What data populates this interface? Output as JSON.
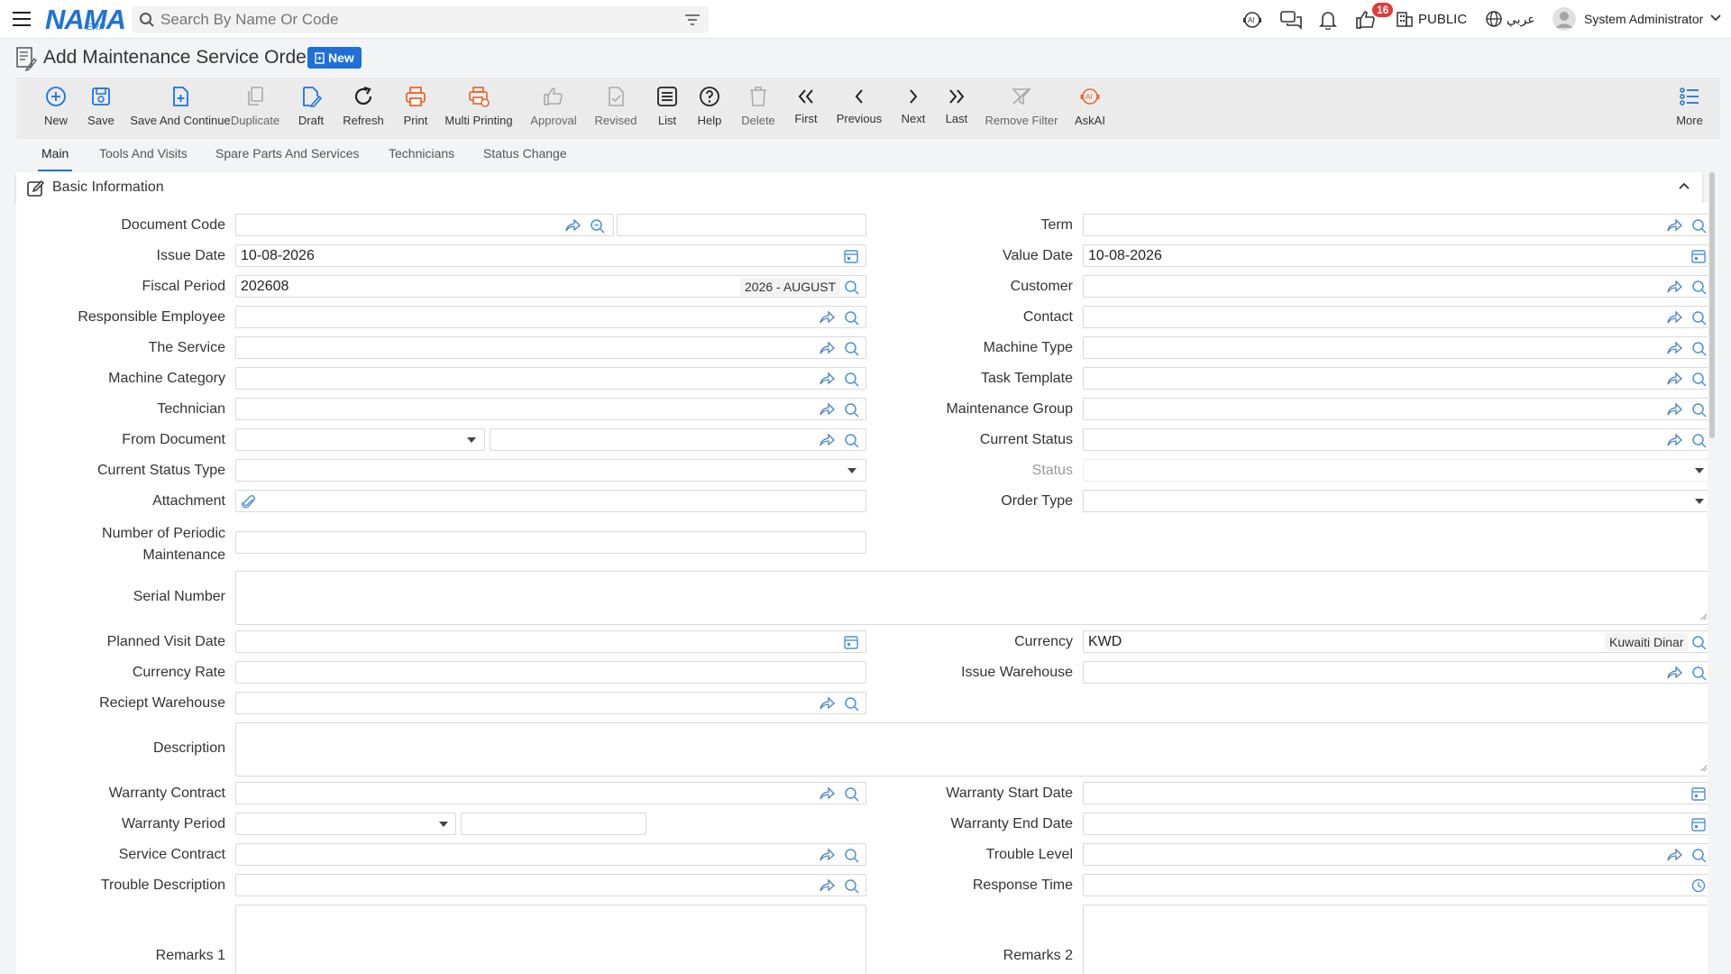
{
  "header": {
    "logo": "NAMA",
    "logo_sub": "ERP",
    "search_placeholder": "Search By Name Or Code",
    "notification_count": "16",
    "company": "PUBLIC",
    "language": "عربي",
    "user": "System Administrator"
  },
  "page": {
    "title": "Add Maintenance Service Order",
    "badge": "New"
  },
  "toolbar": {
    "new": "New",
    "save": "Save",
    "save_continue": "Save And Continue",
    "duplicate": "Duplicate",
    "draft": "Draft",
    "refresh": "Refresh",
    "print": "Print",
    "multi_printing": "Multi Printing",
    "approval": "Approval",
    "revised": "Revised",
    "list": "List",
    "help": "Help",
    "delete": "Delete",
    "first": "First",
    "previous": "Previous",
    "next": "Next",
    "last": "Last",
    "remove_filter": "Remove Filter",
    "askai": "AskAI",
    "more": "More"
  },
  "tabs": [
    "Main",
    "Tools And Visits",
    "Spare Parts And Services",
    "Technicians",
    "Status Change"
  ],
  "section": {
    "title": "Basic Information"
  },
  "form": {
    "document_code": {
      "label": "Document Code",
      "value": ""
    },
    "term": {
      "label": "Term",
      "value": ""
    },
    "issue_date": {
      "label": "Issue Date",
      "value": "10-08-2026"
    },
    "value_date": {
      "label": "Value Date",
      "value": "10-08-2026"
    },
    "fiscal_period": {
      "label": "Fiscal Period",
      "value": "202608",
      "tag": "2026 - AUGUST"
    },
    "customer": {
      "label": "Customer",
      "value": ""
    },
    "responsible_employee": {
      "label": "Responsible Employee",
      "value": ""
    },
    "contact": {
      "label": "Contact",
      "value": ""
    },
    "the_service": {
      "label": "The Service",
      "value": ""
    },
    "machine_type": {
      "label": "Machine Type",
      "value": ""
    },
    "machine_category": {
      "label": "Machine Category",
      "value": ""
    },
    "task_template": {
      "label": "Task Template",
      "value": ""
    },
    "technician": {
      "label": "Technician",
      "value": ""
    },
    "maintenance_group": {
      "label": "Maintenance Group",
      "value": ""
    },
    "from_document": {
      "label": "From Document",
      "value": ""
    },
    "current_status": {
      "label": "Current Status",
      "value": ""
    },
    "current_status_type": {
      "label": "Current Status Type",
      "value": ""
    },
    "status": {
      "label": "Status",
      "value": ""
    },
    "attachment": {
      "label": "Attachment",
      "value": ""
    },
    "order_type": {
      "label": "Order Type",
      "value": ""
    },
    "number_of_periodic_maintenance": {
      "label_line1": "Number of Periodic",
      "label_line2": "Maintenance",
      "value": ""
    },
    "serial_number": {
      "label": "Serial Number",
      "value": ""
    },
    "planned_visit_date": {
      "label": "Planned Visit Date",
      "value": ""
    },
    "currency": {
      "label": "Currency",
      "value": "KWD",
      "tag": "Kuwaiti Dinar"
    },
    "currency_rate": {
      "label": "Currency Rate",
      "value": ""
    },
    "issue_warehouse": {
      "label": "Issue Warehouse",
      "value": ""
    },
    "reciept_warehouse": {
      "label": "Reciept Warehouse",
      "value": ""
    },
    "description": {
      "label": "Description",
      "value": ""
    },
    "warranty_contract": {
      "label": "Warranty Contract",
      "value": ""
    },
    "warranty_start_date": {
      "label": "Warranty Start Date",
      "value": ""
    },
    "warranty_period": {
      "label": "Warranty Period",
      "value": ""
    },
    "warranty_end_date": {
      "label": "Warranty End Date",
      "value": ""
    },
    "service_contract": {
      "label": "Service Contract",
      "value": ""
    },
    "trouble_level": {
      "label": "Trouble Level",
      "value": ""
    },
    "trouble_description": {
      "label": "Trouble Description",
      "value": ""
    },
    "response_time": {
      "label": "Response Time",
      "value": ""
    },
    "remarks_1": {
      "label": "Remarks 1",
      "value": ""
    },
    "remarks_2": {
      "label": "Remarks 2",
      "value": ""
    }
  },
  "colors": {
    "accent": "#1e73d8",
    "print": "#e8692e",
    "badge_red": "#e53935"
  }
}
